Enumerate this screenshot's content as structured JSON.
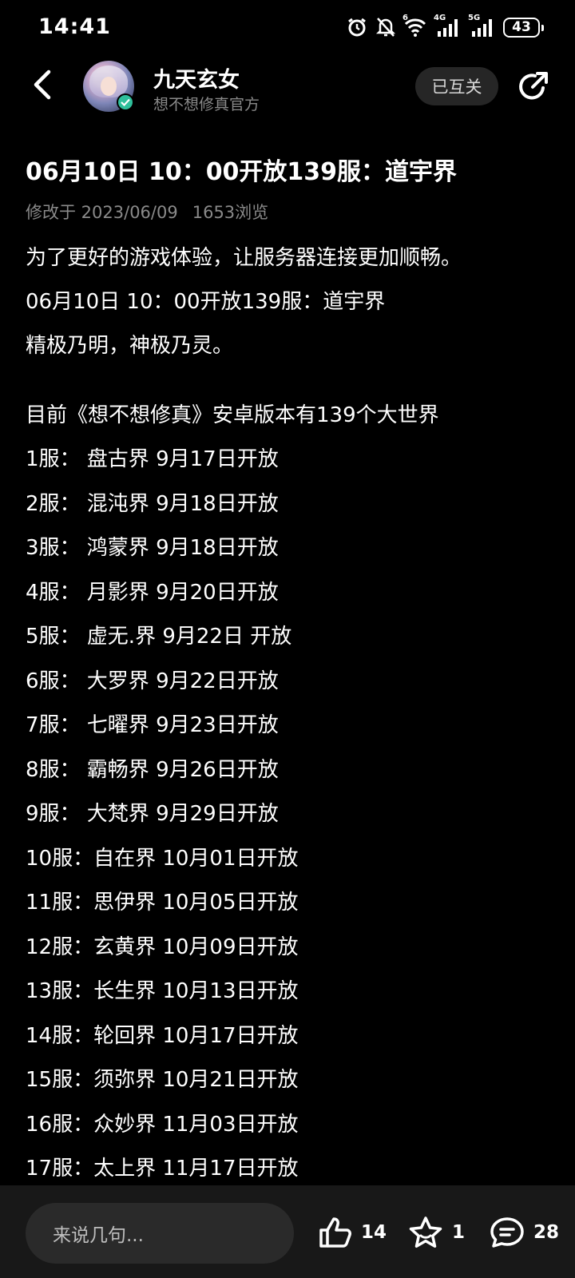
{
  "status_bar": {
    "time": "14:41",
    "icons": [
      "alarm-icon",
      "mute-bell-icon",
      "wifi-icon",
      "signal-4g-icon",
      "signal-5g-icon"
    ],
    "wifi_tag": "6",
    "net1_tag": "4G",
    "net2_tag": "5G",
    "battery": "43"
  },
  "header": {
    "author_name": "九天玄女",
    "author_subtitle": "想不想修真官方",
    "follow_label": "已互关"
  },
  "article": {
    "title": "06月10日 10：00开放139服：道宇界",
    "modified": "修改于 2023/06/09",
    "views": "1653浏览",
    "paragraphs": [
      "为了更好的游戏体验，让服务器连接更加顺畅。",
      "06月10日 10：00开放139服：道宇界",
      "精极乃明，神极乃灵。"
    ],
    "intro": "目前《想不想修真》安卓版本有139个大世界",
    "servers": [
      "1服：  盘古界 9月17日开放",
      "2服：  混沌界 9月18日开放",
      "3服：  鸿蒙界 9月18日开放",
      "4服：  月影界 9月20日开放",
      "5服：  虚无.界 9月22日 开放",
      "6服：  大罗界 9月22日开放",
      "7服：  七曜界 9月23日开放",
      "8服：  霸畅界 9月26日开放",
      "9服：  大梵界 9月29日开放",
      "10服：自在界 10月01日开放",
      "11服：思伊界 10月05日开放",
      "12服：玄黄界 10月09日开放",
      "13服：长生界 10月13日开放",
      "14服：轮回界 10月17日开放",
      "15服：须弥界 10月21日开放",
      "16服：众妙界 11月03日开放",
      "17服：太上界 11月17日开放"
    ]
  },
  "bottom_bar": {
    "comment_placeholder": "来说几句...",
    "likes": "14",
    "favorites": "1",
    "comments": "28"
  },
  "colors": {
    "background": "#000000",
    "secondary_text": "#8a8a8a",
    "bottom_bar": "#181818",
    "input_bg": "#2a2a2a",
    "verified": "#2fbf9b"
  }
}
